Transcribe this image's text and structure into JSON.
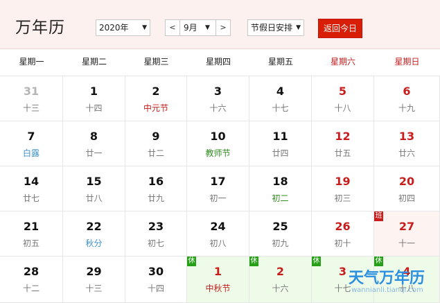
{
  "header": {
    "title": "万年历",
    "year_select": "2020年",
    "month_prev": "<",
    "month_select": "9月",
    "month_next": ">",
    "holiday_select": "节假日安排",
    "today_button": "返回今日",
    "caret": "▼"
  },
  "weekdays": [
    "星期一",
    "星期二",
    "星期三",
    "星期四",
    "星期五",
    "星期六",
    "星期日"
  ],
  "weeks": [
    [
      {
        "day": "31",
        "lunar": "十三",
        "other": true
      },
      {
        "day": "1",
        "lunar": "十四"
      },
      {
        "day": "2",
        "lunar": "中元节",
        "lunar_color": "red"
      },
      {
        "day": "3",
        "lunar": "十六"
      },
      {
        "day": "4",
        "lunar": "十七"
      },
      {
        "day": "5",
        "lunar": "十八"
      },
      {
        "day": "6",
        "lunar": "十九"
      }
    ],
    [
      {
        "day": "7",
        "lunar": "白露",
        "lunar_color": "blue"
      },
      {
        "day": "8",
        "lunar": "廿一"
      },
      {
        "day": "9",
        "lunar": "廿二"
      },
      {
        "day": "10",
        "lunar": "教师节",
        "lunar_color": "green"
      },
      {
        "day": "11",
        "lunar": "廿四"
      },
      {
        "day": "12",
        "lunar": "廿五"
      },
      {
        "day": "13",
        "lunar": "廿六"
      }
    ],
    [
      {
        "day": "14",
        "lunar": "廿七"
      },
      {
        "day": "15",
        "lunar": "廿八"
      },
      {
        "day": "16",
        "lunar": "廿九"
      },
      {
        "day": "17",
        "lunar": "初一"
      },
      {
        "day": "18",
        "lunar": "初二",
        "lunar_color": "green"
      },
      {
        "day": "19",
        "lunar": "初三"
      },
      {
        "day": "20",
        "lunar": "初四"
      }
    ],
    [
      {
        "day": "21",
        "lunar": "初五"
      },
      {
        "day": "22",
        "lunar": "秋分",
        "lunar_color": "blue"
      },
      {
        "day": "23",
        "lunar": "初七"
      },
      {
        "day": "24",
        "lunar": "初八"
      },
      {
        "day": "25",
        "lunar": "初九"
      },
      {
        "day": "26",
        "lunar": "初十"
      },
      {
        "day": "27",
        "lunar": "十一",
        "tag": "班",
        "tag_type": "work"
      }
    ],
    [
      {
        "day": "28",
        "lunar": "十二"
      },
      {
        "day": "29",
        "lunar": "十三"
      },
      {
        "day": "30",
        "lunar": "十四"
      },
      {
        "day": "1",
        "lunar": "中秋节",
        "lunar_color": "red",
        "tag": "休",
        "tag_type": "rest"
      },
      {
        "day": "2",
        "lunar": "十六",
        "tag": "休",
        "tag_type": "rest"
      },
      {
        "day": "3",
        "lunar": "十七",
        "tag": "休",
        "tag_type": "rest"
      },
      {
        "day": "4",
        "lunar": "十八",
        "tag": "休",
        "tag_type": "rest"
      }
    ]
  ],
  "watermark": {
    "title": "天气万年历",
    "url": "wannianli.tianqi.com"
  }
}
